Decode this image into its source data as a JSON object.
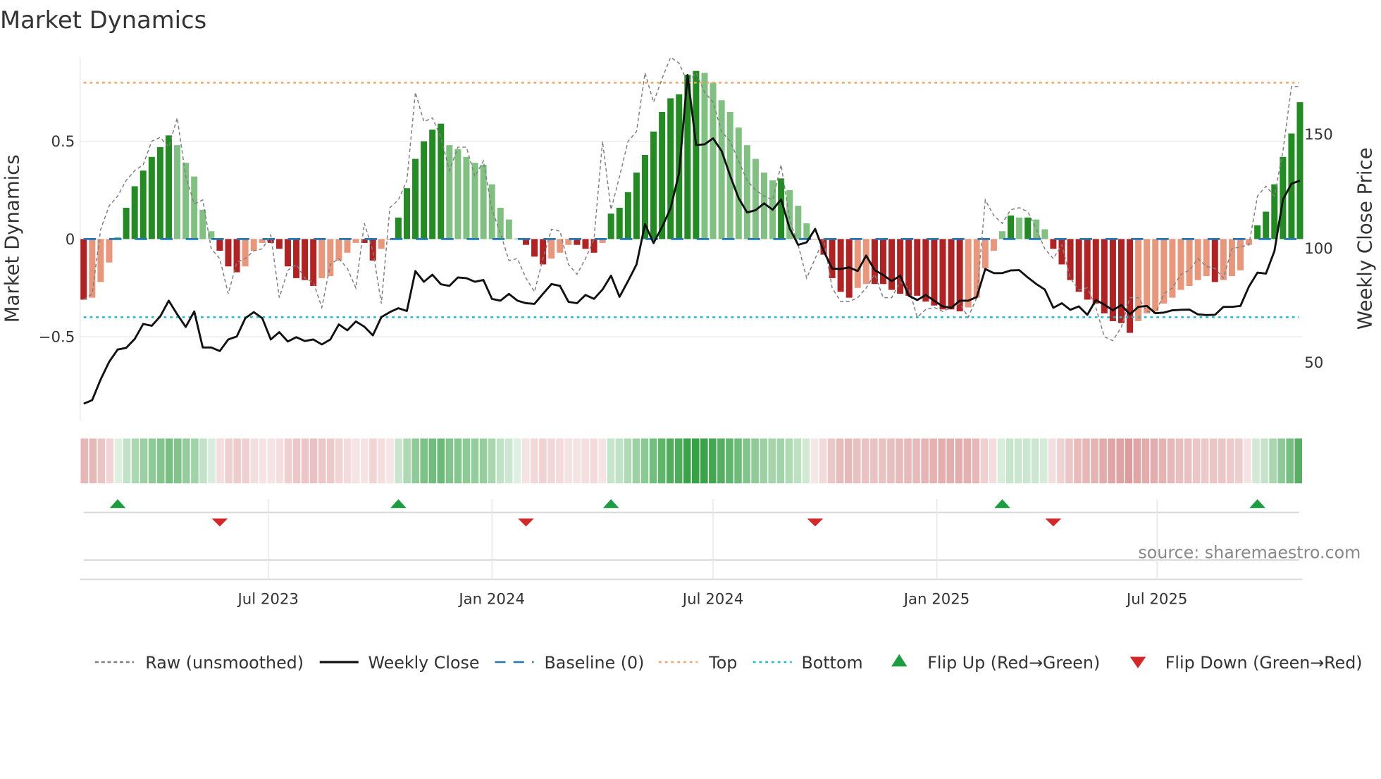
{
  "chart_data": {
    "type": "bar",
    "title": "Market Dynamics",
    "ylabel": "Market Dynamics",
    "y2label": "Weekly Close Price",
    "ylim": [
      -0.93,
      0.93
    ],
    "y2lim": [
      24.3,
      183.8
    ],
    "frequency": "weekly",
    "yticks": [
      {
        "v": 0.5,
        "label": "0.5"
      },
      {
        "v": 0,
        "label": "0"
      },
      {
        "v": -0.5,
        "label": "−0.5"
      }
    ],
    "y2ticks": [
      {
        "v": 150,
        "label": "150"
      },
      {
        "v": 100,
        "label": "100"
      },
      {
        "v": 50,
        "label": "50"
      }
    ],
    "xticks": [
      {
        "index": 21.7,
        "label": "Jul 2023"
      },
      {
        "index": 48.0,
        "label": "Jan 2024"
      },
      {
        "index": 74.0,
        "label": "Jul 2024"
      },
      {
        "index": 100.3,
        "label": "Jan 2025"
      },
      {
        "index": 126.2,
        "label": "Jul 2025"
      }
    ],
    "top_level": 0.8,
    "bottom_level": -0.4,
    "baseline": 0,
    "grid": true,
    "legend_placement": "bottom",
    "series": [
      {
        "name": "Market Dynamics (smoothed)",
        "values": [
          -0.31,
          -0.3,
          -0.22,
          -0.12,
          0.01,
          0.16,
          0.27,
          0.35,
          0.42,
          0.47,
          0.53,
          0.48,
          0.39,
          0.32,
          0.15,
          0.04,
          -0.06,
          -0.14,
          -0.17,
          -0.14,
          -0.06,
          -0.02,
          -0.02,
          -0.05,
          -0.14,
          -0.2,
          -0.21,
          -0.24,
          -0.2,
          -0.19,
          -0.11,
          -0.07,
          -0.02,
          -0.02,
          -0.11,
          -0.05,
          -0.005,
          0.11,
          0.26,
          0.41,
          0.5,
          0.56,
          0.59,
          0.48,
          0.46,
          0.42,
          0.39,
          0.38,
          0.28,
          0.16,
          0.1,
          0.003,
          -0.03,
          -0.09,
          -0.13,
          -0.1,
          -0.07,
          -0.03,
          -0.03,
          -0.05,
          -0.07,
          -0.02,
          0.13,
          0.16,
          0.24,
          0.34,
          0.43,
          0.55,
          0.65,
          0.72,
          0.74,
          0.84,
          0.86,
          0.85,
          0.8,
          0.71,
          0.65,
          0.57,
          0.48,
          0.41,
          0.34,
          0.3,
          0.31,
          0.25,
          0.17,
          0.08,
          -0.003,
          -0.08,
          -0.2,
          -0.27,
          -0.3,
          -0.25,
          -0.23,
          -0.23,
          -0.23,
          -0.26,
          -0.28,
          -0.29,
          -0.29,
          -0.32,
          -0.34,
          -0.36,
          -0.36,
          -0.37,
          -0.35,
          -0.3,
          -0.15,
          -0.06,
          0.04,
          0.12,
          0.11,
          0.11,
          0.1,
          0.05,
          -0.05,
          -0.13,
          -0.21,
          -0.27,
          -0.31,
          -0.33,
          -0.38,
          -0.42,
          -0.43,
          -0.48,
          -0.42,
          -0.38,
          -0.37,
          -0.33,
          -0.3,
          -0.26,
          -0.24,
          -0.21,
          -0.19,
          -0.22,
          -0.21,
          -0.19,
          -0.16,
          -0.03,
          0.07,
          0.14,
          0.28,
          0.42,
          0.54,
          0.7
        ]
      },
      {
        "name": "Raw (unsmoothed)",
        "values": [
          -0.31,
          -0.28,
          0.05,
          0.17,
          0.22,
          0.3,
          0.35,
          0.38,
          0.5,
          0.52,
          0.47,
          0.62,
          0.32,
          0.18,
          0.2,
          -0.05,
          -0.1,
          -0.28,
          -0.12,
          -0.1,
          -0.06,
          -0.05,
          0.02,
          -0.3,
          -0.16,
          -0.13,
          -0.2,
          -0.22,
          -0.35,
          -0.13,
          -0.1,
          -0.15,
          -0.25,
          0.08,
          -0.06,
          -0.33,
          0.16,
          0.2,
          0.3,
          0.75,
          0.6,
          0.62,
          0.52,
          0.35,
          0.47,
          0.47,
          0.32,
          0.4,
          0.15,
          0.03,
          -0.11,
          -0.1,
          -0.2,
          -0.27,
          -0.1,
          0.05,
          0.04,
          -0.13,
          -0.18,
          -0.1,
          0.0,
          0.5,
          0.15,
          0.32,
          0.5,
          0.55,
          0.85,
          0.7,
          0.82,
          0.93,
          0.9,
          0.8,
          0.85,
          0.75,
          0.7,
          0.55,
          0.5,
          0.4,
          0.3,
          0.25,
          0.22,
          0.2,
          0.38,
          0.1,
          -0.03,
          -0.2,
          -0.1,
          0.0,
          -0.25,
          -0.32,
          -0.32,
          -0.3,
          -0.25,
          -0.18,
          -0.3,
          -0.3,
          -0.22,
          -0.25,
          -0.4,
          -0.36,
          -0.35,
          -0.37,
          -0.35,
          -0.33,
          -0.4,
          -0.3,
          0.2,
          0.12,
          0.08,
          0.15,
          0.16,
          0.14,
          0.05,
          -0.05,
          -0.1,
          -0.03,
          -0.2,
          -0.26,
          -0.25,
          -0.35,
          -0.5,
          -0.52,
          -0.45,
          -0.3,
          -0.3,
          -0.37,
          -0.38,
          -0.28,
          -0.25,
          -0.18,
          -0.16,
          -0.1,
          -0.14,
          -0.15,
          -0.2,
          -0.05,
          -0.04,
          -0.03,
          0.22,
          0.27,
          0.22,
          0.45,
          0.78,
          0.78
        ]
      },
      {
        "name": "Weekly Close",
        "axis": "right",
        "values": [
          31.8,
          33.4,
          42.5,
          50.2,
          55.6,
          56.3,
          60.2,
          66.8,
          66.0,
          70.1,
          77.0,
          71.0,
          65.5,
          72.3,
          56.5,
          56.5,
          54.9,
          60.0,
          61.3,
          69.3,
          72.0,
          69.3,
          60.0,
          63.2,
          59.1,
          61.0,
          59.3,
          60.0,
          57.8,
          60.0,
          66.6,
          64.0,
          67.9,
          65.6,
          61.8,
          69.8,
          72.0,
          73.7,
          72.5,
          90.0,
          85.3,
          88.4,
          84.2,
          83.5,
          87.2,
          86.9,
          85.3,
          86.1,
          77.8,
          77.0,
          80.0,
          77.0,
          75.9,
          75.6,
          80.0,
          84.3,
          83.5,
          76.5,
          75.9,
          79.5,
          77.8,
          81.9,
          88.0,
          78.7,
          85.6,
          92.9,
          110.6,
          102.3,
          109.3,
          117.5,
          133.0,
          176.0,
          145.3,
          145.6,
          148.2,
          142.7,
          131.9,
          122.0,
          115.7,
          116.7,
          119.7,
          116.9,
          121.4,
          108.7,
          101.5,
          102.6,
          108.5,
          98.8,
          91.1,
          90.9,
          91.6,
          90.0,
          96.8,
          90.4,
          88.3,
          85.6,
          88.0,
          79.2,
          77.3,
          79.5,
          77.0,
          74.5,
          73.9,
          77.0,
          77.0,
          78.6,
          90.9,
          89.1,
          89.1,
          90.3,
          90.4,
          87.2,
          84.3,
          81.9,
          73.9,
          75.9,
          73.0,
          74.5,
          70.8,
          77.3,
          75.3,
          72.8,
          75.1,
          71.0,
          74.3,
          74.7,
          71.5,
          71.8,
          72.8,
          73.0,
          73.1,
          71.0,
          70.7,
          70.8,
          74.3,
          74.3,
          74.7,
          83.2,
          89.3,
          88.9,
          98.8,
          121.4,
          128.3,
          129.7
        ]
      }
    ],
    "flips_up": [
      4,
      37,
      62,
      108,
      138
    ],
    "flips_down": [
      16,
      52,
      86,
      114
    ],
    "legend": [
      {
        "label": "Raw (unsmoothed)",
        "style": "dashed",
        "color": "#808080"
      },
      {
        "label": "Weekly Close",
        "style": "solid",
        "color": "#111111"
      },
      {
        "label": "Baseline (0)",
        "style": "dashed",
        "color": "#1f77b4"
      },
      {
        "label": "Top",
        "style": "dotted",
        "color": "#f4a460"
      },
      {
        "label": "Bottom",
        "style": "dotted",
        "color": "#17becf"
      },
      {
        "label": "Flip Up (Red→Green)",
        "style": "triangle-up",
        "color": "#1a9e3f"
      },
      {
        "label": "Flip Down (Green→Red)",
        "style": "triangle-down",
        "color": "#d62728"
      }
    ],
    "colors": {
      "strong_up": "#228b22",
      "weak_up": "#80c080",
      "strong_down": "#b22222",
      "weak_down": "#e9967a"
    },
    "source": "source: sharemaestro.com"
  }
}
